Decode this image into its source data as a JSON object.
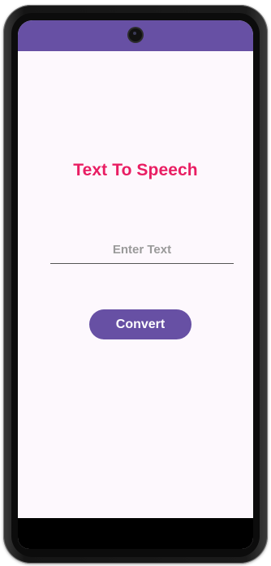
{
  "colors": {
    "status_bar": "#6750a4",
    "title": "#e91e63",
    "button_bg": "#6750a4",
    "button_text": "#ffffff",
    "screen_bg": "#fdf8fd",
    "nav_bar": "#000000"
  },
  "icons": {
    "camera": "front-camera-icon"
  },
  "main": {
    "title": "Text To Speech",
    "input": {
      "value": "",
      "placeholder": "Enter Text"
    },
    "convert_label": "Convert"
  }
}
